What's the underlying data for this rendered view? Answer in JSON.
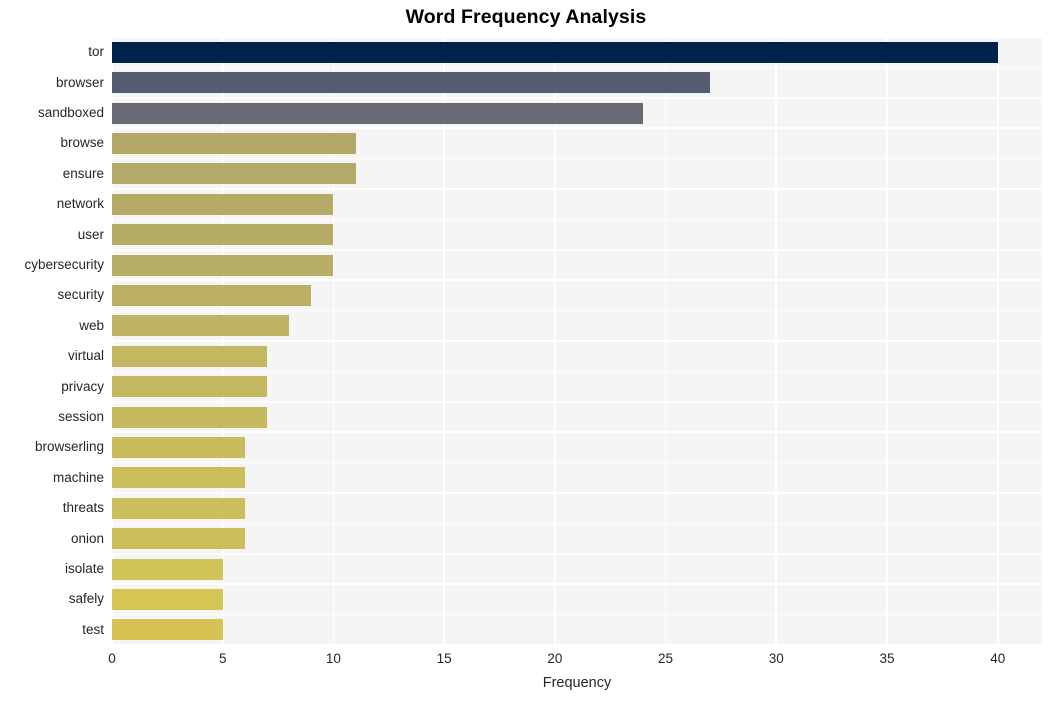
{
  "chart_data": {
    "type": "bar",
    "orientation": "horizontal",
    "title": "Word Frequency Analysis",
    "xlabel": "Frequency",
    "ylabel": "",
    "categories": [
      "tor",
      "browser",
      "sandboxed",
      "browse",
      "ensure",
      "network",
      "user",
      "cybersecurity",
      "security",
      "web",
      "virtual",
      "privacy",
      "session",
      "browserling",
      "machine",
      "threats",
      "onion",
      "isolate",
      "safely",
      "test"
    ],
    "values": [
      40,
      27,
      24,
      11,
      11,
      10,
      10,
      10,
      9,
      8,
      7,
      7,
      7,
      6,
      6,
      6,
      6,
      5,
      5,
      5
    ],
    "bar_colors": [
      "#00234e",
      "#565c72",
      "#676a73",
      "#b2a868",
      "#b3a968",
      "#b5ab66",
      "#b6ac66",
      "#b7ad65",
      "#bbb062",
      "#bfb461",
      "#c3b75f",
      "#c4b85e",
      "#c5b95e",
      "#c9bc5c",
      "#cabd5b",
      "#cbbe5b",
      "#ccbf5a",
      "#d2c356",
      "#d4c555",
      "#d7c354"
    ],
    "xlim": [
      0,
      42
    ],
    "xticks": [
      0,
      5,
      10,
      15,
      20,
      25,
      30,
      35,
      40
    ],
    "xtick_labels": [
      "0",
      "5",
      "10",
      "15",
      "20",
      "25",
      "30",
      "35",
      "40"
    ],
    "grid": true,
    "grid_color": "#ffffff",
    "plot_background": "#f5f5f5",
    "figure_background": "#ffffff",
    "legend": null
  }
}
